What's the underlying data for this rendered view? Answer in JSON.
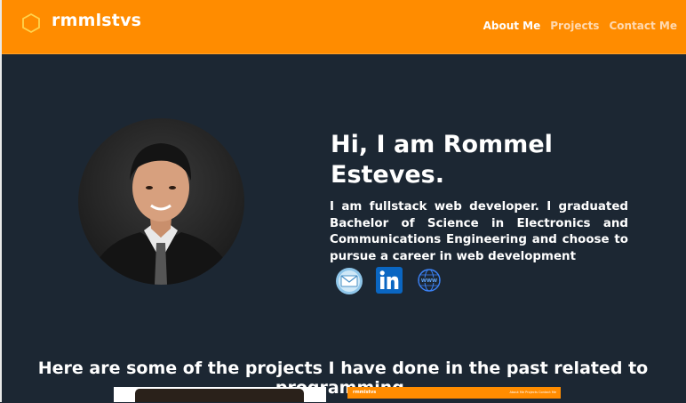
{
  "brand": {
    "name": "rmmlstvs",
    "icon": "hexagon-icon"
  },
  "nav": {
    "items": [
      {
        "label": "About Me",
        "active": true
      },
      {
        "label": "Projects",
        "active": false
      },
      {
        "label": "Contact Me",
        "active": false
      }
    ]
  },
  "hero": {
    "headline": "Hi, I am Rommel Esteves.",
    "bio": "I am fullstack web developer. I graduated Bachelor of Science in Electronics and Communications Engineering and choose to pursue a career in web development",
    "photo": "profile-photo",
    "socials": [
      {
        "name": "email",
        "icon": "mail-icon"
      },
      {
        "name": "linkedin",
        "icon": "linkedin-icon"
      },
      {
        "name": "website",
        "icon": "www-globe-icon"
      }
    ]
  },
  "projects": {
    "heading": "Here are some of the projects I have done in the past related to programming.",
    "thumbnails": [
      {
        "name": "project-1"
      },
      {
        "name": "project-2",
        "mini_brand": "rmmlstvs",
        "mini_nav": "About Me   Projects   Contact Me"
      }
    ]
  },
  "colors": {
    "accent": "#ff8c00",
    "background": "#1c2733",
    "text": "#ffffff",
    "nav_inactive": "#ffd9b0"
  }
}
